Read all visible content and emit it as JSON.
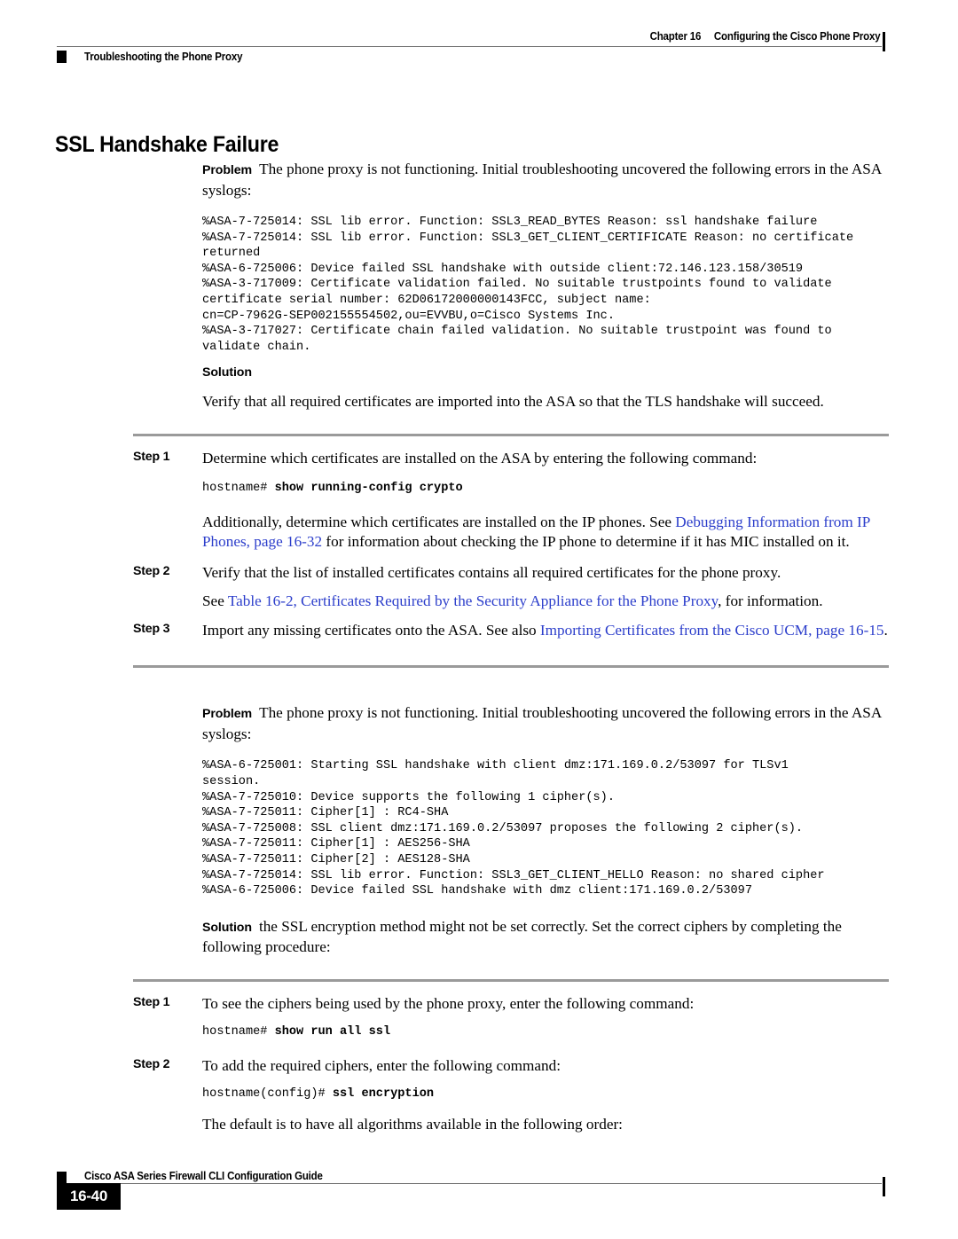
{
  "header": {
    "chapter_number": "Chapter 16",
    "chapter_title": "Configuring the Cisco Phone Proxy",
    "section_title": "Troubleshooting the Phone Proxy"
  },
  "page_title": "SSL Handshake Failure",
  "section1": {
    "problem_label": "Problem",
    "problem_text": "The phone proxy is not functioning. Initial troubleshooting uncovered the following errors in the ASA syslogs:",
    "syslog_lines": [
      "%ASA-7-725014: SSL lib error. Function: SSL3_READ_BYTES Reason: ssl handshake failure",
      "%ASA-7-725014: SSL lib error. Function: SSL3_GET_CLIENT_CERTIFICATE Reason: no certificate",
      "returned",
      "%ASA-6-725006: Device failed SSL handshake with outside client:72.146.123.158/30519",
      "%ASA-3-717009: Certificate validation failed. No suitable trustpoints found to validate",
      "certificate serial number: 62D06172000000143FCC, subject name:",
      "cn=CP-7962G-SEP002155554502,ou=EVVBU,o=Cisco Systems Inc.",
      "%ASA-3-717027: Certificate chain failed validation. No suitable trustpoint was found to",
      "validate chain."
    ],
    "solution_label": "Solution",
    "solution_text": "Verify that all required certificates are imported into the ASA so that the TLS handshake will succeed.",
    "steps": [
      {
        "label": "Step 1",
        "text": "Determine which certificates are installed on the ASA by entering the following command:",
        "command_prompt": "hostname# ",
        "command": "show running-config crypto",
        "followup_pre": "Additionally, determine which certificates are installed on the IP phones. See ",
        "followup_link": "Debugging Information from IP Phones, page 16-32",
        "followup_post": " for information about checking the IP phone to determine if it has MIC installed on it."
      },
      {
        "label": "Step 2",
        "text": "Verify that the list of installed certificates contains all required certificates for the phone proxy.",
        "subnote_pre": "See ",
        "subnote_link": "Table 16-2, Certificates Required by the Security Appliance for the Phone Proxy",
        "subnote_post": ", for information."
      },
      {
        "label": "Step 3",
        "text_pre": "Import any missing certificates onto the ASA. See also ",
        "text_link": "Importing Certificates from the Cisco UCM, page 16-15",
        "text_post": "."
      }
    ]
  },
  "section2": {
    "problem_label": "Problem",
    "problem_text": "The phone proxy is not functioning. Initial troubleshooting uncovered the following errors in the ASA syslogs:",
    "syslog_lines": [
      "%ASA-6-725001: Starting SSL handshake with client dmz:171.169.0.2/53097 for TLSv1",
      "session.",
      "%ASA-7-725010: Device supports the following 1 cipher(s).",
      "%ASA-7-725011: Cipher[1] : RC4-SHA",
      "%ASA-7-725008: SSL client dmz:171.169.0.2/53097 proposes the following 2 cipher(s).",
      "%ASA-7-725011: Cipher[1] : AES256-SHA",
      "%ASA-7-725011: Cipher[2] : AES128-SHA",
      "%ASA-7-725014: SSL lib error. Function: SSL3_GET_CLIENT_HELLO Reason: no shared cipher",
      "%ASA-6-725006: Device failed SSL handshake with dmz client:171.169.0.2/53097"
    ],
    "solution_label": "Solution",
    "solution_text": "the SSL encryption method might not be set correctly. Set the correct ciphers by completing the following procedure:",
    "steps": [
      {
        "label": "Step 1",
        "text": "To see the ciphers being used by the phone proxy, enter the following command:",
        "command_prompt": "hostname# ",
        "command": "show run all ssl"
      },
      {
        "label": "Step 2",
        "text": "To add the required ciphers, enter the following command:",
        "command_prompt": "hostname(config)# ",
        "command": "ssl encryption"
      }
    ],
    "closing_text": "The default is to have all algorithms available in the following order:"
  },
  "footer": {
    "guide_title": "Cisco ASA Series Firewall CLI Configuration Guide",
    "page_number": "16-40"
  },
  "colors": {
    "link": "#2c3ecb",
    "rule": "#9a9a9a",
    "text": "#000000"
  }
}
